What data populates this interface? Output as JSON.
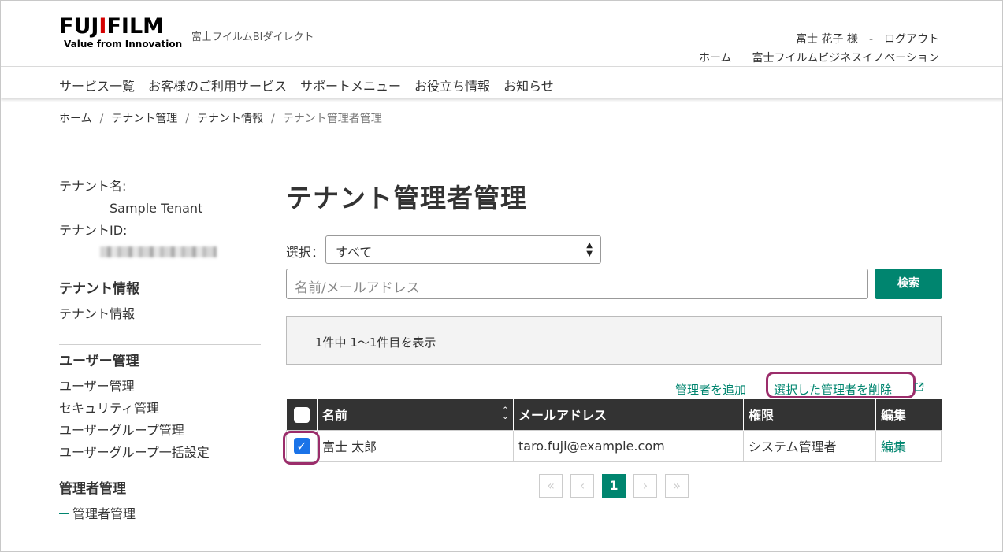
{
  "header": {
    "logo_main": "FUJIFILM",
    "logo_tagline": "Value from Innovation",
    "site_name": "富士フイルムBIダイレクト",
    "user_name": "富士 花子 様",
    "separator": "-",
    "logout": "ログアウト",
    "links": [
      "ホーム",
      "富士フイルムビジネスイノベーション"
    ]
  },
  "gnav": {
    "items": [
      "サービス一覧",
      "お客様のご利用サービス",
      "サポートメニュー",
      "お役立ち情報",
      "お知らせ"
    ]
  },
  "breadcrumb": {
    "items": [
      "ホーム",
      "テナント管理",
      "テナント情報"
    ],
    "current": "テナント管理者管理",
    "separator": "/"
  },
  "sidebar": {
    "tenant_name_label": "テナント名:",
    "tenant_name_value": "Sample Tenant",
    "tenant_id_label": "テナントID:",
    "sections": [
      {
        "title": "テナント情報",
        "links": [
          "テナント情報"
        ]
      },
      {
        "title": "ユーザー管理",
        "links": [
          "ユーザー管理",
          "セキュリティ管理",
          "ユーザーグループ管理",
          "ユーザーグループ一括設定"
        ]
      },
      {
        "title": "管理者管理",
        "links": [
          "管理者管理"
        ]
      }
    ]
  },
  "main": {
    "title": "テナント管理者管理",
    "filter_label": "選択：",
    "filter_value": "すべて",
    "search_placeholder": "名前/メールアドレス",
    "search_button": "検索",
    "result_summary": "1件中 1〜1件目を表示",
    "add_admin": "管理者を追加",
    "delete_selected": "選択した管理者を削除",
    "table": {
      "headers": [
        "名前",
        "メールアドレス",
        "権限",
        "編集"
      ],
      "rows": [
        {
          "checked": true,
          "name": "富士 太郎",
          "email": "taro.fuji@example.com",
          "role": "システム管理者",
          "edit": "編集"
        }
      ]
    },
    "pagination": {
      "first": "«",
      "prev": "‹",
      "current": "1",
      "next": "›",
      "last": "»"
    }
  },
  "colors": {
    "accent": "#00856f",
    "highlight": "#9b2d6b",
    "table_header": "#333333",
    "checkbox": "#1a73e8"
  }
}
